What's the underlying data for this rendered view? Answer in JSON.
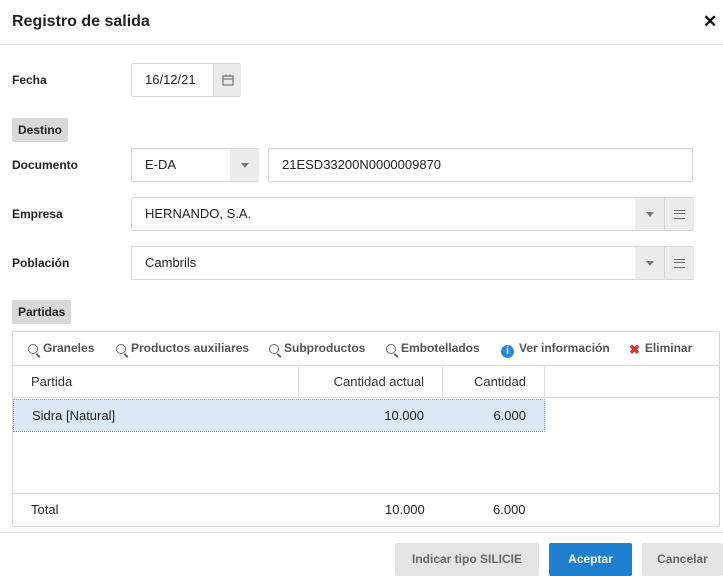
{
  "dialog": {
    "title": "Registro de salida"
  },
  "fecha": {
    "label": "Fecha",
    "value": "16/12/21"
  },
  "destino": {
    "section_label": "Destino"
  },
  "documento": {
    "label": "Documento",
    "type_value": "E-DA",
    "number_value": "21ESD33200N0000009870"
  },
  "empresa": {
    "label": "Empresa",
    "value": "HERNANDO, S.A."
  },
  "poblacion": {
    "label": "Población",
    "value": "Cambrils"
  },
  "partidas": {
    "section_label": "Partidas",
    "toolbar": {
      "graneles": "Graneles",
      "productos_auxiliares": "Productos auxiliares",
      "subproductos": "Subproductos",
      "embotellados": "Embotellados",
      "ver_informacion": "Ver información",
      "eliminar": "Eliminar"
    },
    "columns": {
      "partida": "Partida",
      "cantidad_actual": "Cantidad actual",
      "cantidad": "Cantidad"
    },
    "rows": [
      {
        "partida": "Sidra [Natural]",
        "cantidad_actual": "10.000",
        "cantidad": "6.000"
      }
    ],
    "total": {
      "label": "Total",
      "cantidad_actual": "10.000",
      "cantidad": "6.000"
    }
  },
  "footer": {
    "silicie_label": "Indicar tipo SILICIE",
    "accept_label": "Aceptar",
    "cancel_label": "Cancelar"
  },
  "colors": {
    "primary": "#1e7fcf",
    "selected_row": "#dce7f4",
    "delete": "#d9342b",
    "info": "#2f86d4"
  }
}
